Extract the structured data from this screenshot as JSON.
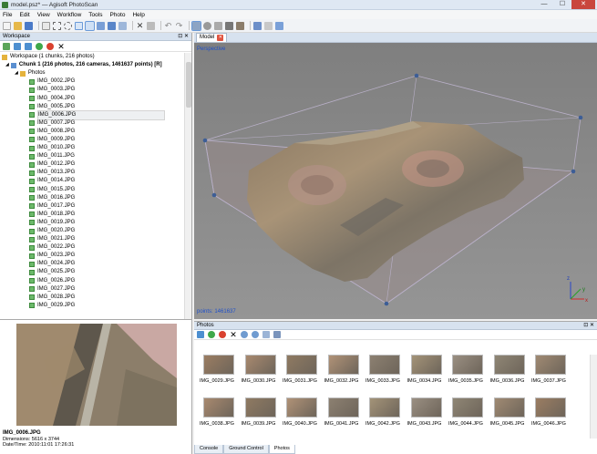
{
  "window": {
    "title": "model.psz* — Agisoft PhotoScan",
    "min": "—",
    "max": "☐",
    "close": "✕"
  },
  "menu": [
    "File",
    "Edit",
    "View",
    "Workflow",
    "Tools",
    "Photo",
    "Help"
  ],
  "workspace": {
    "header": "Workspace",
    "header_controls": "⊡ ✕",
    "root": "Workspace (1 chunks, 216 photos)",
    "chunk": "Chunk 1 (216 photos, 216 cameras, 1461637 points) [R]",
    "folder": "Photos",
    "photos": [
      "IMG_0002.JPG",
      "IMG_0003.JPG",
      "IMG_0004.JPG",
      "IMG_0005.JPG",
      "IMG_0006.JPG",
      "IMG_0007.JPG",
      "IMG_0008.JPG",
      "IMG_0009.JPG",
      "IMG_0010.JPG",
      "IMG_0011.JPG",
      "IMG_0012.JPG",
      "IMG_0013.JPG",
      "IMG_0014.JPG",
      "IMG_0015.JPG",
      "IMG_0016.JPG",
      "IMG_0017.JPG",
      "IMG_0018.JPG",
      "IMG_0019.JPG",
      "IMG_0020.JPG",
      "IMG_0021.JPG",
      "IMG_0022.JPG",
      "IMG_0023.JPG",
      "IMG_0024.JPG",
      "IMG_0025.JPG",
      "IMG_0026.JPG",
      "IMG_0027.JPG",
      "IMG_0028.JPG",
      "IMG_0029.JPG"
    ],
    "selected_index": 4
  },
  "model": {
    "tab": "Model",
    "projection": "Perspective",
    "points": "points: 1461637",
    "axes": {
      "x": "x",
      "y": "y",
      "z": "z"
    }
  },
  "preview": {
    "filename": "IMG_0006.JPG",
    "dimensions": "Dimensions: 5616 x 3744",
    "datetime": "Date/Time: 2010:11:01 17:26:31"
  },
  "photos_pane": {
    "header": "Photos",
    "header_controls": "⊡ ✕",
    "row1": [
      "IMG_0029.JPG",
      "IMG_0030.JPG",
      "IMG_0031.JPG",
      "IMG_0032.JPG",
      "IMG_0033.JPG",
      "IMG_0034.JPG",
      "IMG_0035.JPG",
      "IMG_0036.JPG",
      "IMG_0037.JPG"
    ],
    "row2": [
      "IMG_0038.JPG",
      "IMG_0039.JPG",
      "IMG_0040.JPG",
      "IMG_0041.JPG",
      "IMG_0042.JPG",
      "IMG_0043.JPG",
      "IMG_0044.JPG",
      "IMG_0045.JPG",
      "IMG_0046.JPG"
    ]
  },
  "bottom_tabs": [
    "Console",
    "Ground Control",
    "Photos"
  ]
}
